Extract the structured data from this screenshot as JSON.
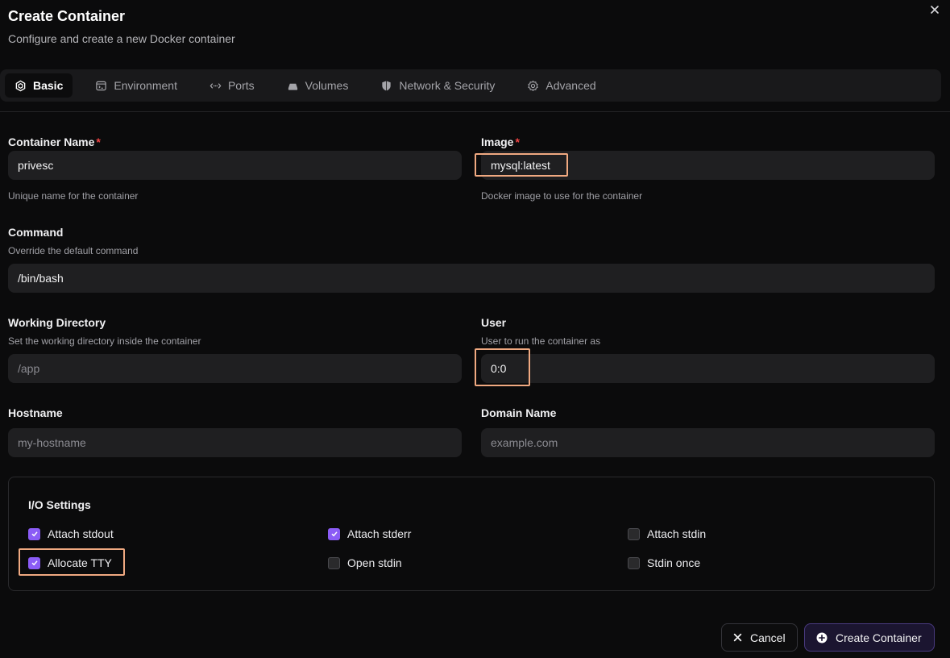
{
  "dialog": {
    "title": "Create Container",
    "subtitle": "Configure and create a new Docker container",
    "close_icon": "x-icon"
  },
  "tabs": [
    {
      "label": "Basic",
      "icon": "docker-hex-icon",
      "active": true
    },
    {
      "label": "Environment",
      "icon": "env-icon",
      "active": false
    },
    {
      "label": "Ports",
      "icon": "arrows-icon",
      "active": false
    },
    {
      "label": "Volumes",
      "icon": "drive-icon",
      "active": false
    },
    {
      "label": "Network & Security",
      "icon": "shield-icon",
      "active": false
    },
    {
      "label": "Advanced",
      "icon": "gear-icon",
      "active": false
    }
  ],
  "fields": {
    "container_name": {
      "label": "Container Name",
      "required": "*",
      "value": "privesc",
      "help": "Unique name for the container"
    },
    "image": {
      "label": "Image",
      "required": "*",
      "value": "mysql:latest",
      "help": "Docker image to use for the container"
    },
    "command": {
      "label": "Command",
      "help": "Override the default command",
      "value": "/bin/bash"
    },
    "working_directory": {
      "label": "Working Directory",
      "help": "Set the working directory inside the container",
      "placeholder": "/app"
    },
    "user": {
      "label": "User",
      "help": "User to run the container as",
      "value": "0:0"
    },
    "hostname": {
      "label": "Hostname",
      "placeholder": "my-hostname"
    },
    "domain_name": {
      "label": "Domain Name",
      "placeholder": "example.com"
    }
  },
  "io_settings": {
    "title": "I/O Settings",
    "options": [
      {
        "label": "Attach stdout",
        "checked": true
      },
      {
        "label": "Attach stderr",
        "checked": true
      },
      {
        "label": "Attach stdin",
        "checked": false
      },
      {
        "label": "Allocate TTY",
        "checked": true
      },
      {
        "label": "Open stdin",
        "checked": false
      },
      {
        "label": "Stdin once",
        "checked": false
      }
    ]
  },
  "buttons": {
    "cancel": "Cancel",
    "create": "Create Container"
  },
  "colors": {
    "accent": "#8b5cf6",
    "highlight": "#f0a981",
    "required": "#ef4444",
    "background": "#0b0b0c"
  }
}
